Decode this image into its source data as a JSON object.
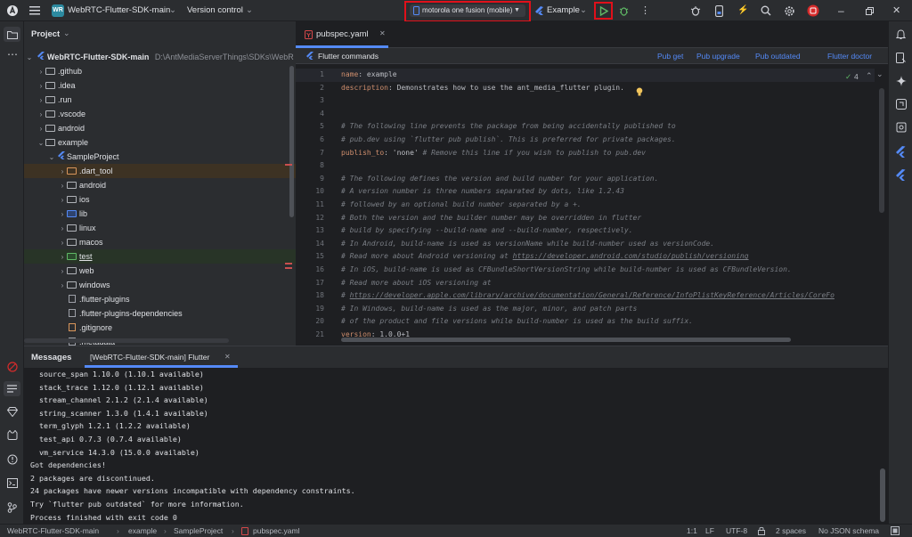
{
  "titlebar": {
    "project_badge": "WR",
    "project_name": "WebRTC-Flutter-SDK-main",
    "vcs": "Version control",
    "device": "motorola one fusion (mobile)",
    "run_config": "Example"
  },
  "project_panel": {
    "title": "Project",
    "root_name": "WebRTC-Flutter-SDK-main",
    "root_path": "D:\\AntMediaServerThings\\SDKs\\WebR",
    "items": [
      {
        "label": ".github",
        "kind": "folder"
      },
      {
        "label": ".idea",
        "kind": "folder"
      },
      {
        "label": ".run",
        "kind": "folder"
      },
      {
        "label": ".vscode",
        "kind": "folder"
      },
      {
        "label": "android",
        "kind": "folder"
      },
      {
        "label": "example",
        "kind": "folder"
      },
      {
        "label": "SampleProject",
        "kind": "module"
      },
      {
        "label": ".dart_tool",
        "kind": "folder"
      },
      {
        "label": "android",
        "kind": "folder"
      },
      {
        "label": "ios",
        "kind": "folder"
      },
      {
        "label": "lib",
        "kind": "folder"
      },
      {
        "label": "linux",
        "kind": "folder"
      },
      {
        "label": "macos",
        "kind": "folder"
      },
      {
        "label": "test",
        "kind": "folder"
      },
      {
        "label": "web",
        "kind": "folder"
      },
      {
        "label": "windows",
        "kind": "folder"
      },
      {
        "label": ".flutter-plugins",
        "kind": "file"
      },
      {
        "label": ".flutter-plugins-dependencies",
        "kind": "file"
      },
      {
        "label": ".gitignore",
        "kind": "file"
      },
      {
        "label": ".metadata",
        "kind": "file"
      }
    ]
  },
  "editor": {
    "tab_label": "pubspec.yaml",
    "flutter_commands": "Flutter commands",
    "actions": [
      "Pub get",
      "Pub upgrade",
      "Pub outdated",
      "Flutter doctor"
    ],
    "inspection_count": "4",
    "lines": [
      {
        "n": "1",
        "text": "name: example"
      },
      {
        "n": "2",
        "text": "description: Demonstrates how to use the ant_media_flutter plugin."
      },
      {
        "n": "3",
        "text": ""
      },
      {
        "n": "4",
        "text": ""
      },
      {
        "n": "5",
        "text": "# The following line prevents the package from being accidentally published to"
      },
      {
        "n": "6",
        "text": "# pub.dev using `flutter pub publish`. This is preferred for private packages."
      },
      {
        "n": "7",
        "text": "publish_to: 'none' # Remove this line if you wish to publish to pub.dev"
      },
      {
        "n": "8",
        "text": ""
      },
      {
        "n": "9",
        "text": "# The following defines the version and build number for your application."
      },
      {
        "n": "10",
        "text": "# A version number is three numbers separated by dots, like 1.2.43"
      },
      {
        "n": "11",
        "text": "# followed by an optional build number separated by a +."
      },
      {
        "n": "12",
        "text": "# Both the version and the builder number may be overridden in flutter"
      },
      {
        "n": "13",
        "text": "# build by specifying --build-name and --build-number, respectively."
      },
      {
        "n": "14",
        "text": "# In Android, build-name is used as versionName while build-number used as versionCode."
      },
      {
        "n": "15",
        "text": "# Read more about Android versioning at https://developer.android.com/studio/publish/versioning"
      },
      {
        "n": "16",
        "text": "# In iOS, build-name is used as CFBundleShortVersionString while build-number is used as CFBundleVersion."
      },
      {
        "n": "17",
        "text": "# Read more about iOS versioning at"
      },
      {
        "n": "18",
        "text": "# https://developer.apple.com/library/archive/documentation/General/Reference/InfoPlistKeyReference/Articles/CoreFo"
      },
      {
        "n": "19",
        "text": "# In Windows, build-name is used as the major, minor, and patch parts"
      },
      {
        "n": "20",
        "text": "# of the product and file versions while build-number is used as the build suffix."
      },
      {
        "n": "21",
        "text": "version: 1.0.0+1"
      }
    ]
  },
  "messages": {
    "tab_messages": "Messages",
    "tab_flutter": "[WebRTC-Flutter-SDK-main] Flutter",
    "output": [
      "  source_span 1.10.0 (1.10.1 available)",
      "  stack_trace 1.12.0 (1.12.1 available)",
      "  stream_channel 2.1.2 (2.1.4 available)",
      "  string_scanner 1.3.0 (1.4.1 available)",
      "  term_glyph 1.2.1 (1.2.2 available)",
      "  test_api 0.7.3 (0.7.4 available)",
      "  vm_service 14.3.0 (15.0.0 available)",
      "Got dependencies!",
      "2 packages are discontinued.",
      "24 packages have newer versions incompatible with dependency constraints.",
      "Try `flutter pub outdated` for more information.",
      "Process finished with exit code 0"
    ]
  },
  "statusbar": {
    "breadcrumb": [
      "WebRTC-Flutter-SDK-main",
      "example",
      "SampleProject",
      "pubspec.yaml"
    ],
    "position": "1:1",
    "line_sep": "LF",
    "encoding": "UTF-8",
    "indent": "2 spaces",
    "schema": "No JSON schema"
  },
  "colors": {
    "accent": "#548af7",
    "highlight_box": "#e0101a",
    "run_green": "#5fb865"
  }
}
